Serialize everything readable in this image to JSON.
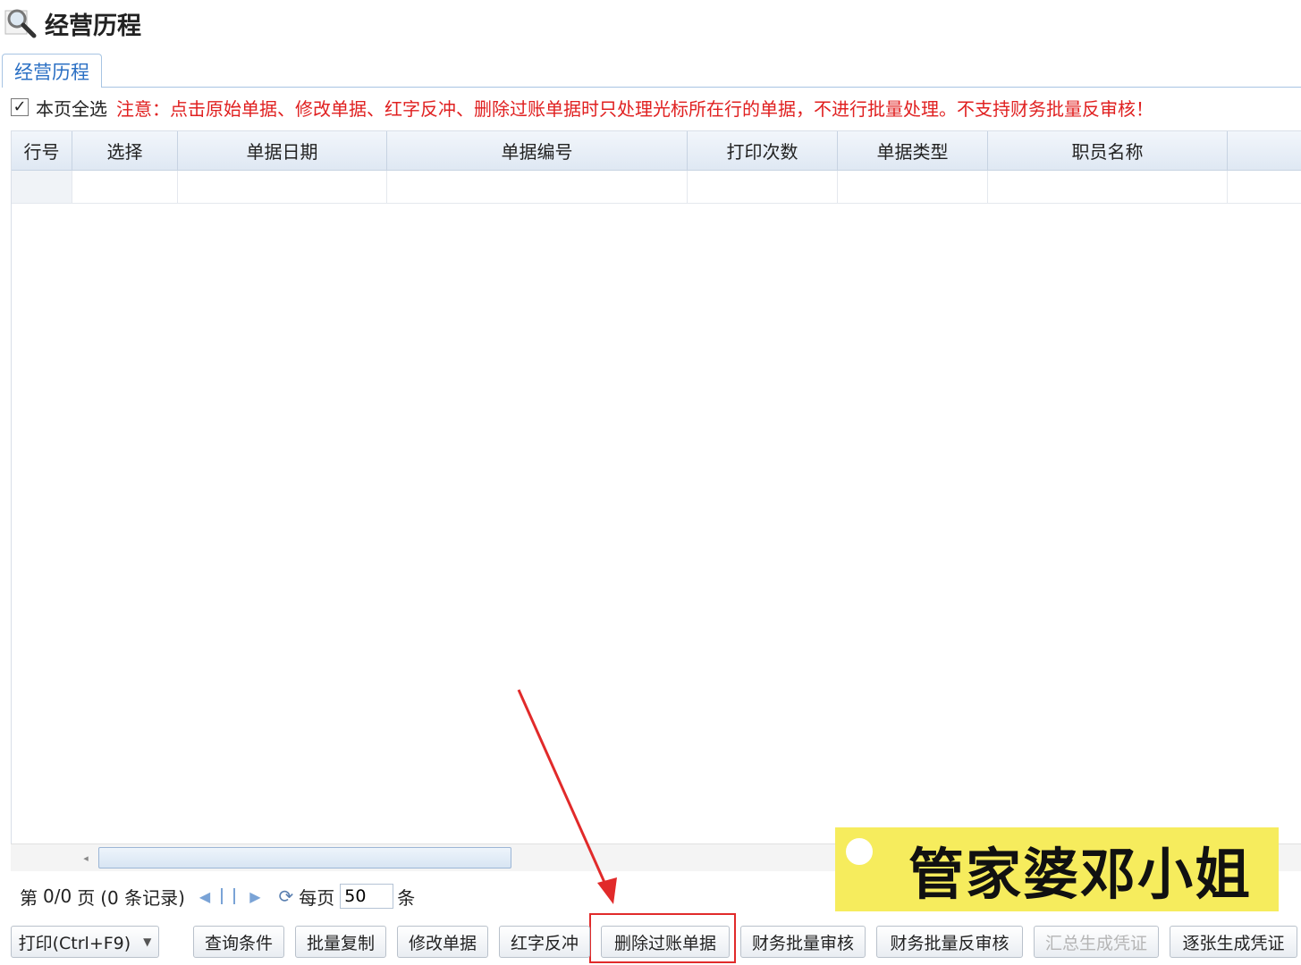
{
  "page": {
    "title": "经营历程"
  },
  "tabs": [
    {
      "label": "经营历程",
      "active": true
    }
  ],
  "select_all": {
    "label": "本页全选",
    "checked": true
  },
  "notice": "注意：点击原始单据、修改单据、红字反冲、删除过账单据时只处理光标所在行的单据，不进行批量处理。不支持财务批量反审核！",
  "grid": {
    "columns": [
      "行号",
      "选择",
      "单据日期",
      "单据编号",
      "打印次数",
      "单据类型",
      "职员名称"
    ],
    "rows": []
  },
  "pager": {
    "page_text": "第",
    "page_value": "0/0",
    "page_unit": "页",
    "records_text": "(0 条记录)",
    "per_page_label": "每页",
    "per_page_value": "50",
    "per_page_unit": "条"
  },
  "toolbar": {
    "print": "打印(Ctrl+F9)",
    "query": "查询条件",
    "batch_copy": "批量复制",
    "modify": "修改单据",
    "red_reverse": "红字反冲",
    "delete_posted": "删除过账单据",
    "fin_batch_audit": "财务批量审核",
    "fin_batch_unaudit": "财务批量反审核",
    "summary_voucher": "汇总生成凭证",
    "single_voucher": "逐张生成凭证"
  },
  "watermark": {
    "text": "管家婆邓小姐"
  },
  "colors": {
    "accent": "#2b70c4",
    "notice": "#e02020",
    "highlight": "#e12a2a",
    "watermark_bg": "#f6ec5d"
  }
}
